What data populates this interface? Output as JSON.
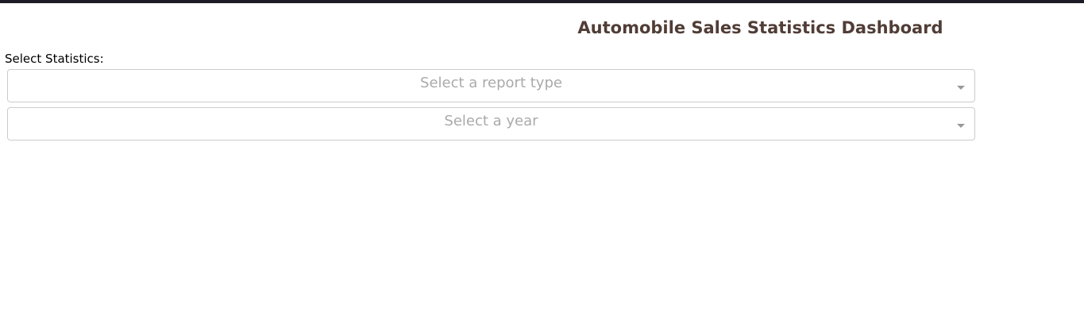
{
  "header": {
    "title": "Automobile Sales Statistics Dashboard",
    "title_color": "#503d36",
    "top_bar_color": "#1d1b26"
  },
  "controls": {
    "statistics_label": "Select Statistics:",
    "report_type_dropdown": {
      "placeholder": "Select a report type",
      "selected": ""
    },
    "year_dropdown": {
      "placeholder": "Select a year",
      "selected": ""
    }
  },
  "icons": {
    "dropdown_arrow": "caret-down-icon"
  }
}
